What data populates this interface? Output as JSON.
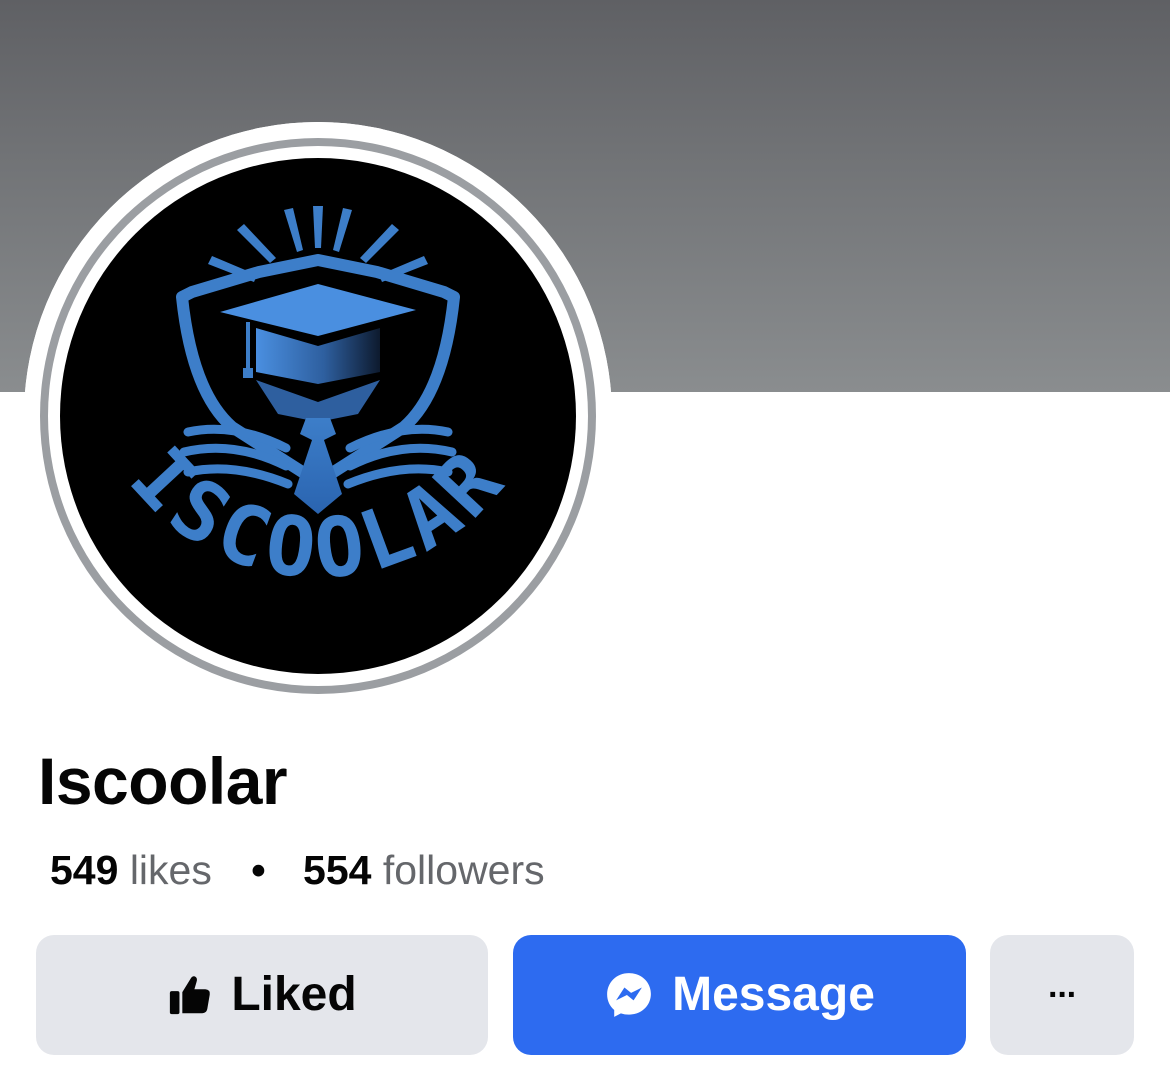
{
  "cover": {
    "color_top": "#5f6064",
    "color_bottom": "#8a8d8f"
  },
  "profile": {
    "avatar_logo_text": "ISCOOLAR",
    "name": "Iscoolar",
    "likes_count": "549",
    "likes_label": "likes",
    "separator": "•",
    "followers_count": "554",
    "followers_label": "followers"
  },
  "actions": {
    "liked_label": "Liked",
    "liked_icon": "thumbs-up-icon",
    "message_label": "Message",
    "message_icon": "messenger-icon",
    "more_label": "···",
    "more_icon": "more-options-icon"
  },
  "colors": {
    "primary_blue": "#2d6bf0",
    "button_gray": "#e4e6eb",
    "logo_blue": "#3d7ec9",
    "text_dark": "#050505",
    "text_secondary": "#65676b"
  }
}
